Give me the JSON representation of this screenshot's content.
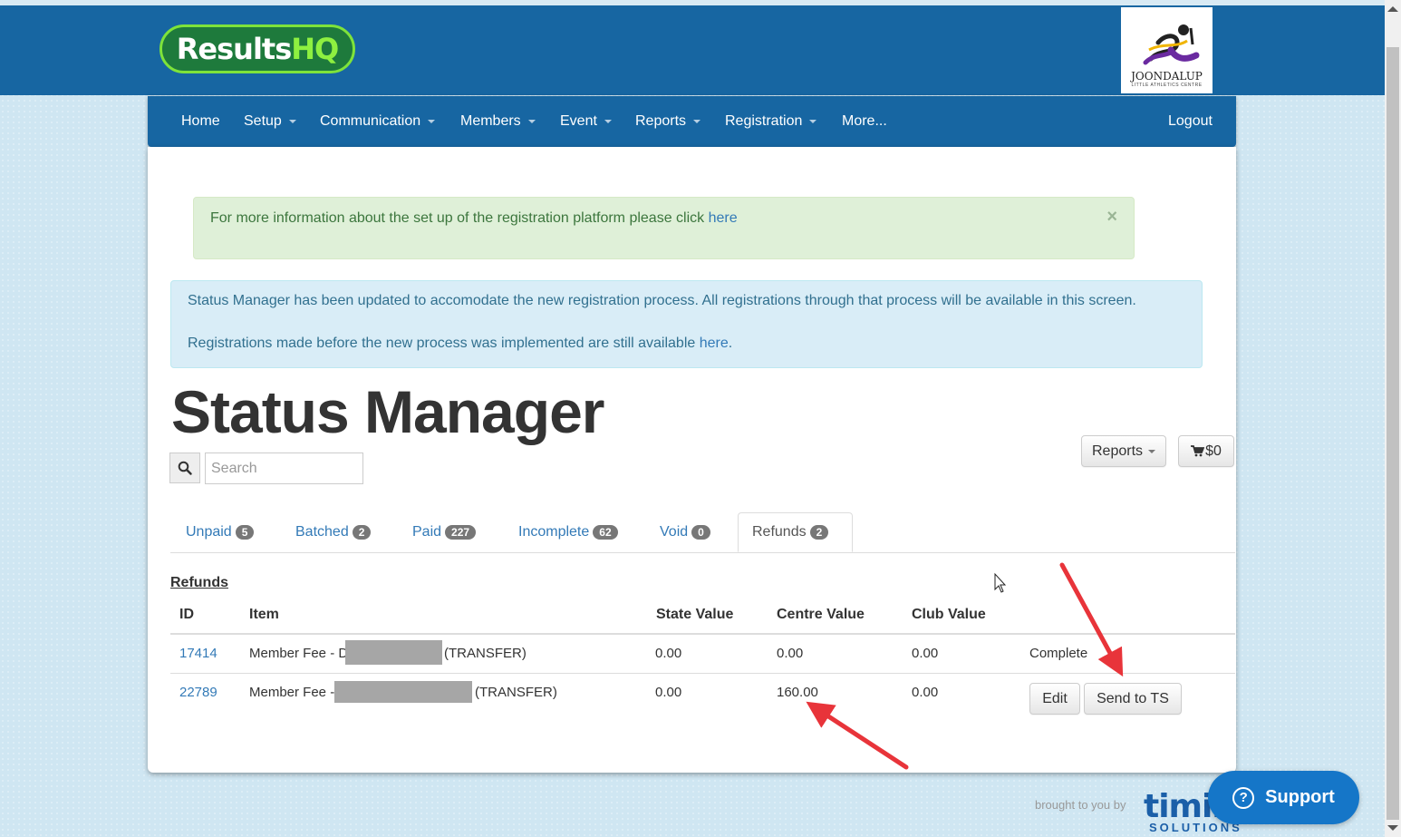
{
  "header": {
    "logo_main": "Results",
    "logo_accent": "HQ",
    "club_name": "JOONDALUP",
    "club_sub": "LITTLE ATHLETICS CENTRE"
  },
  "nav": {
    "items": [
      {
        "label": "Home"
      },
      {
        "label": "Setup"
      },
      {
        "label": "Communication"
      },
      {
        "label": "Members"
      },
      {
        "label": "Event"
      },
      {
        "label": "Reports"
      },
      {
        "label": "Registration"
      },
      {
        "label": "More..."
      }
    ],
    "logout": "Logout"
  },
  "alerts": {
    "success_text": "For more information about the set up of the registration platform please click ",
    "success_link": "here",
    "close": "×",
    "info_line1": "Status Manager has been updated to accomodate the new registration process. All registrations through that process will be available in this screen.",
    "info_line2": "Registrations made before the new process was implemented are still available ",
    "info_link": "here",
    "info_period": "."
  },
  "page": {
    "title": "Status Manager"
  },
  "search": {
    "placeholder": "Search"
  },
  "toolbar": {
    "reports": "Reports",
    "cart": "$0"
  },
  "tabs": [
    {
      "label": "Unpaid",
      "count": "5"
    },
    {
      "label": "Batched",
      "count": "2"
    },
    {
      "label": "Paid",
      "count": "227"
    },
    {
      "label": "Incomplete",
      "count": "62"
    },
    {
      "label": "Void",
      "count": "0"
    },
    {
      "label": "Refunds",
      "count": "2"
    }
  ],
  "table": {
    "heading": "Refunds",
    "columns": [
      "ID",
      "Item",
      "State Value",
      "Centre Value",
      "Club Value"
    ],
    "rows": [
      {
        "id": "17414",
        "item_prefix": "Member Fee - D",
        "item_suffix": "(TRANSFER)",
        "state": "0.00",
        "centre": "0.00",
        "club": "0.00",
        "status": "Complete"
      },
      {
        "id": "22789",
        "item_prefix": "Member Fee -",
        "item_suffix": "(TRANSFER)",
        "state": "0.00",
        "centre": "160.00",
        "club": "0.00",
        "edit": "Edit",
        "send": "Send to TS"
      }
    ]
  },
  "footer": {
    "brought_by": "brought to you by",
    "timing_main": "timing",
    "timing_sub": "SOLUTIONS"
  },
  "support": {
    "label": "Support"
  },
  "colors": {
    "header": "#1766a2",
    "link": "#337ab7",
    "annotation_arrow": "#e8343a"
  }
}
